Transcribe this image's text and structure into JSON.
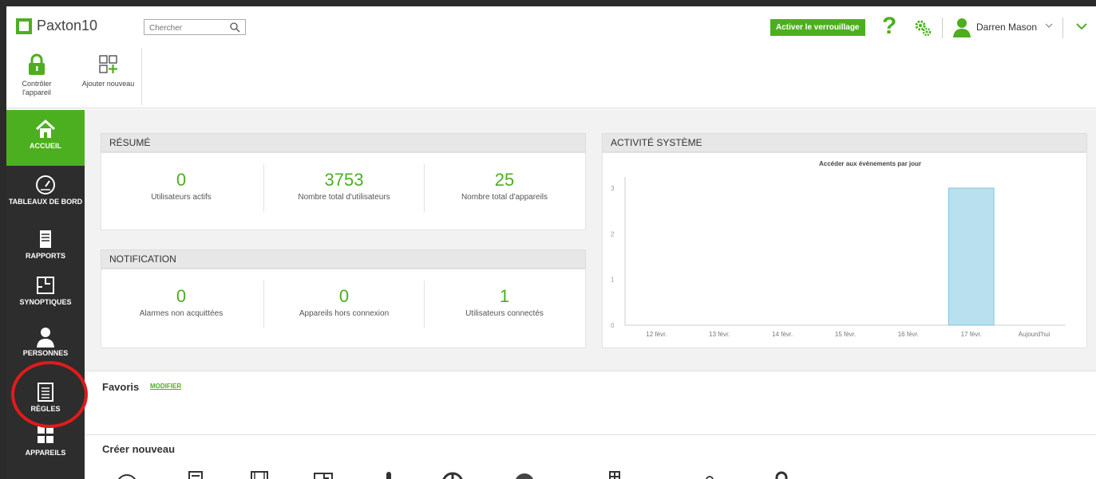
{
  "app": {
    "name": "Paxton10",
    "brand_color": "#4caf1f"
  },
  "header": {
    "search_placeholder": "Chercher",
    "lock_button": "Activer le verrouillage",
    "help_glyph": "?",
    "user_name": "Darren Mason"
  },
  "toolbar": {
    "control_label_1": "Contrôler",
    "control_label_2": "l'appareil",
    "add_label": "Ajouter nouveau"
  },
  "sidebar": {
    "items": [
      {
        "label": "ACCUEIL",
        "icon": "home-icon",
        "active": true
      },
      {
        "label": "TABLEAUX DE BORD",
        "icon": "gauge-icon",
        "active": false
      },
      {
        "label": "RAPPORTS",
        "icon": "report-icon",
        "active": false
      },
      {
        "label": "SYNOPTIQUES",
        "icon": "floorplan-icon",
        "active": false
      },
      {
        "label": "PERSONNES",
        "icon": "person-icon",
        "active": false
      },
      {
        "label": "RÈGLES",
        "icon": "rules-icon",
        "active": false
      },
      {
        "label": "APPAREILS",
        "icon": "devices-icon",
        "active": false
      }
    ]
  },
  "summary": {
    "title": "RÉSUMÉ",
    "stats": [
      {
        "value": "0",
        "label": "Utilisateurs actifs"
      },
      {
        "value": "3753",
        "label": "Nombre total d'utilisateurs"
      },
      {
        "value": "25",
        "label": "Nombre total d'appareils"
      }
    ]
  },
  "notification": {
    "title": "NOTIFICATION",
    "stats": [
      {
        "value": "0",
        "label": "Alarmes non acquittées"
      },
      {
        "value": "0",
        "label": "Appareils hors connexion"
      },
      {
        "value": "1",
        "label": "Utilisateurs connectés"
      }
    ]
  },
  "activity": {
    "title": "ACTIVITÉ SYSTÈME"
  },
  "chart_data": {
    "type": "bar",
    "title": "Accéder aux évènements par jour",
    "categories": [
      "12 févr.",
      "13 févr.",
      "14 févr.",
      "15 févr.",
      "16 févr.",
      "17 févr.",
      "Aujourd'hui"
    ],
    "values": [
      0,
      0,
      0,
      0,
      0,
      3,
      0
    ],
    "yticks": [
      0,
      1,
      2,
      3
    ],
    "ylim": [
      0,
      3
    ],
    "xlabel": "",
    "ylabel": "",
    "bar_color": "#b9e0ef",
    "bar_edge_color": "#7fc4dd",
    "grid": false
  },
  "favorites": {
    "title": "Favoris",
    "edit_label": "MODIFIER"
  },
  "create_new": {
    "title": "Créer nouveau",
    "icons": [
      "clock-icon",
      "report-icon",
      "film-icon",
      "floorplan-icon",
      "thermometer-icon",
      "power-icon",
      "disc-icon",
      "building-icon",
      "puzzle-icon",
      "lock-icon"
    ]
  },
  "annotation_color": "#e01b1b"
}
